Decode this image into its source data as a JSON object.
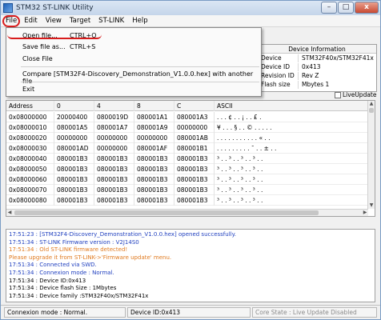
{
  "window": {
    "title": "STM32 ST-LINK Utility"
  },
  "window_controls": {
    "minimize": "–",
    "maximize": "□",
    "close": "x"
  },
  "menu": {
    "file": "File",
    "edit": "Edit",
    "view": "View",
    "target": "Target",
    "stlink": "ST-LINK",
    "help": "Help"
  },
  "file_menu": {
    "open": "Open file...",
    "open_shortcut": "CTRL+O",
    "save": "Save file as...",
    "save_shortcut": "CTRL+S",
    "close": "Close File",
    "compare": "Compare [STM32F4-Discovery_Demonstration_V1.0.0.hex] with another file",
    "exit": "Exit"
  },
  "device_info": {
    "header": "Device Information",
    "rows": [
      {
        "key": "Device",
        "value": "STM32F40x/STM32F41x"
      },
      {
        "key": "Device ID",
        "value": "0x413"
      },
      {
        "key": "Revision ID",
        "value": "Rev Z"
      },
      {
        "key": "Flash size",
        "value": "Mbytes 1"
      }
    ]
  },
  "live_update": {
    "label": "LiveUpdate",
    "checked": false
  },
  "memory_grid": {
    "headers": [
      "Address",
      "0",
      "4",
      "8",
      "C",
      "ASCII"
    ],
    "rows": [
      [
        "0x08000000",
        "20000400",
        "0800019D",
        "080001A1",
        "080001A3",
        ". . . ¢ . . ¡ . . £ ."
      ],
      [
        "0x08000010",
        "080001A5",
        "080001A7",
        "080001A9",
        "00000000",
        "¥ . . . § . . © . . . . ."
      ],
      [
        "0x08000020",
        "00000000",
        "00000000",
        "00000000",
        "080001AB",
        ". . . . . . . . . . . « . ."
      ],
      [
        "0x08000030",
        "080001AD",
        "00000000",
        "080001AF",
        "080001B1",
        ". . . . . . . . . ¯ . . ± . ."
      ],
      [
        "0x08000040",
        "080001B3",
        "080001B3",
        "080001B3",
        "080001B3",
        "³ . . ³ . . ³ . . ³ . ."
      ],
      [
        "0x08000050",
        "080001B3",
        "080001B3",
        "080001B3",
        "080001B3",
        "³ . . ³ . . ³ . . ³ . ."
      ],
      [
        "0x08000060",
        "080001B3",
        "080001B3",
        "080001B3",
        "080001B3",
        "³ . . ³ . . ³ . . ³ . ."
      ],
      [
        "0x08000070",
        "080001B3",
        "080001B3",
        "080001B3",
        "080001B3",
        "³ . . ³ . . ³ . . ³ . ."
      ],
      [
        "0x08000080",
        "080001B3",
        "080001B3",
        "080001B3",
        "080001B3",
        "³ . . ³ . . ³ . . ³ . ."
      ]
    ]
  },
  "log": [
    {
      "text": "17:51:23 : [STM32F4-Discovery_Demonstration_V1.0.0.hex] opened successfully.",
      "color": "#1f3fbf"
    },
    {
      "text": "17:51:34 : ST-LINK Firmware version : V2J14S0",
      "color": "#1f3fbf"
    },
    {
      "text": "17:51:34 : Old ST-LINK firmware detected!",
      "color": "#e07a1f"
    },
    {
      "text": "                Please upgrade it from ST-LINK->'Firmware update' menu.",
      "color": "#e07a1f"
    },
    {
      "text": "17:51:34 : Connected via SWD.",
      "color": "#1f3fbf"
    },
    {
      "text": "17:51:34 : Connexion mode : Normal.",
      "color": "#1f3fbf"
    },
    {
      "text": "17:51:34 : Device ID:0x413",
      "color": "#000000"
    },
    {
      "text": "17:51:34 : Device flash Size : 1Mbytes",
      "color": "#000000"
    },
    {
      "text": "17:51:34 : Device family :STM32F40x/STM32F41x",
      "color": "#000000"
    }
  ],
  "status": {
    "connexion": "Connexion mode : Normal.",
    "device_id": "Device ID:0x413",
    "core_state": "Core State : Live Update Disabled"
  },
  "colors": {
    "highlight": "#d81c1c",
    "log_blue": "#1f3fbf",
    "log_orange": "#e07a1f"
  }
}
